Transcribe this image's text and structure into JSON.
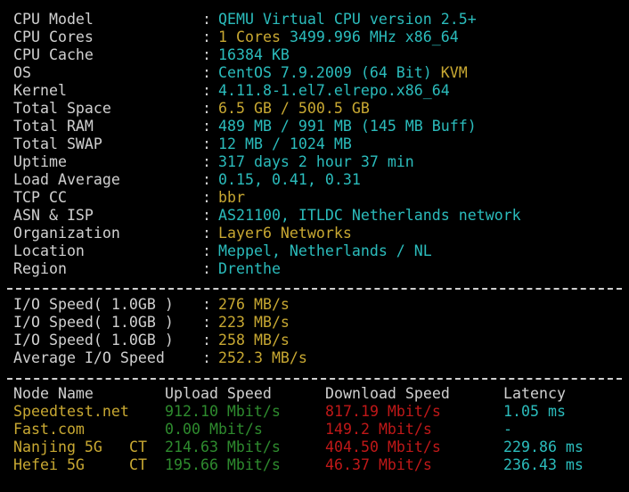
{
  "colors": {
    "background": "#000000",
    "label": "#d0d0d0",
    "cyan": "#2bbcbc",
    "yellow": "#c8a832",
    "green": "#2e8b2e",
    "red": "#c01818",
    "separator": "#cfcfcf"
  },
  "sysinfo": [
    {
      "label": "CPU Model",
      "parts": [
        {
          "text": "QEMU Virtual CPU version 2.5+",
          "color": "cyan"
        }
      ]
    },
    {
      "label": "CPU Cores",
      "parts": [
        {
          "text": "1 Cores ",
          "color": "yellow"
        },
        {
          "text": "3499.996 MHz x86_64",
          "color": "cyan"
        }
      ]
    },
    {
      "label": "CPU Cache",
      "parts": [
        {
          "text": "16384 KB",
          "color": "cyan"
        }
      ]
    },
    {
      "label": "OS",
      "parts": [
        {
          "text": "CentOS 7.9.2009 (64 Bit) ",
          "color": "cyan"
        },
        {
          "text": "KVM",
          "color": "yellow"
        }
      ]
    },
    {
      "label": "Kernel",
      "parts": [
        {
          "text": "4.11.8-1.el7.elrepo.x86_64",
          "color": "cyan"
        }
      ]
    },
    {
      "label": "Total Space",
      "parts": [
        {
          "text": "6.5 GB / 500.5 GB",
          "color": "yellow"
        }
      ]
    },
    {
      "label": "Total RAM",
      "parts": [
        {
          "text": "489 MB / 991 MB (145 MB Buff)",
          "color": "cyan"
        }
      ]
    },
    {
      "label": "Total SWAP",
      "parts": [
        {
          "text": "12 MB / 1024 MB",
          "color": "cyan"
        }
      ]
    },
    {
      "label": "Uptime",
      "parts": [
        {
          "text": "317 days 2 hour 37 min",
          "color": "cyan"
        }
      ]
    },
    {
      "label": "Load Average",
      "parts": [
        {
          "text": "0.15, 0.41, 0.31",
          "color": "cyan"
        }
      ]
    },
    {
      "label": "TCP CC",
      "parts": [
        {
          "text": "bbr",
          "color": "yellow"
        }
      ]
    },
    {
      "label": "ASN & ISP",
      "parts": [
        {
          "text": "AS21100, ITLDC Netherlands network",
          "color": "cyan"
        }
      ]
    },
    {
      "label": "Organization",
      "parts": [
        {
          "text": "Layer6 Networks",
          "color": "yellow"
        }
      ]
    },
    {
      "label": "Location",
      "parts": [
        {
          "text": "Meppel, Netherlands / NL",
          "color": "cyan"
        }
      ]
    },
    {
      "label": "Region",
      "parts": [
        {
          "text": "Drenthe",
          "color": "cyan"
        }
      ]
    }
  ],
  "io": [
    {
      "label": "I/O Speed( 1.0GB )",
      "value": "276 MB/s"
    },
    {
      "label": "I/O Speed( 1.0GB )",
      "value": "223 MB/s"
    },
    {
      "label": "I/O Speed( 1.0GB )",
      "value": "258 MB/s"
    },
    {
      "label": "Average I/O Speed",
      "value": "252.3 MB/s"
    }
  ],
  "speedtest": {
    "headers": {
      "node": "Node Name",
      "upload": "Upload Speed",
      "download": "Download Speed",
      "latency": "Latency"
    },
    "rows": [
      {
        "node": "Speedtest.net",
        "isp": "",
        "upload": "912.10 Mbit/s",
        "download": "817.19 Mbit/s",
        "latency": "1.05 ms"
      },
      {
        "node": "Fast.com",
        "isp": "",
        "upload": "0.00 Mbit/s",
        "download": "149.2 Mbit/s",
        "latency": "-"
      },
      {
        "node": "Nanjing 5G",
        "isp": "CT",
        "upload": "214.63 Mbit/s",
        "download": "404.50 Mbit/s",
        "latency": "229.86 ms"
      },
      {
        "node": "Hefei 5G",
        "isp": "CT",
        "upload": "195.66 Mbit/s",
        "download": "46.37 Mbit/s",
        "latency": "236.43 ms"
      }
    ]
  }
}
